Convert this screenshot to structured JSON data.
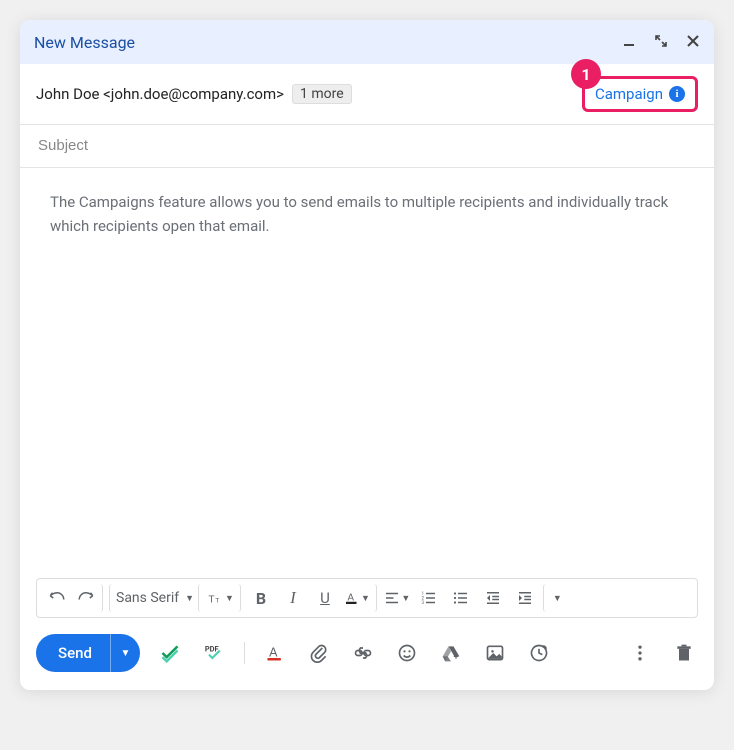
{
  "title": "New Message",
  "recipient": "John Doe <john.doe@company.com>",
  "more_count_label": "1 more",
  "campaign_label": "Campaign",
  "callout_number": "1",
  "subject_placeholder": "Subject",
  "body_text": "The Campaigns feature allows you to send emails to multiple recipients and individually track which recipients open that email.",
  "font_family": "Sans Serif",
  "send_label": "Send",
  "accent_blue": "#1a73e8",
  "accent_pink": "#e91e63"
}
